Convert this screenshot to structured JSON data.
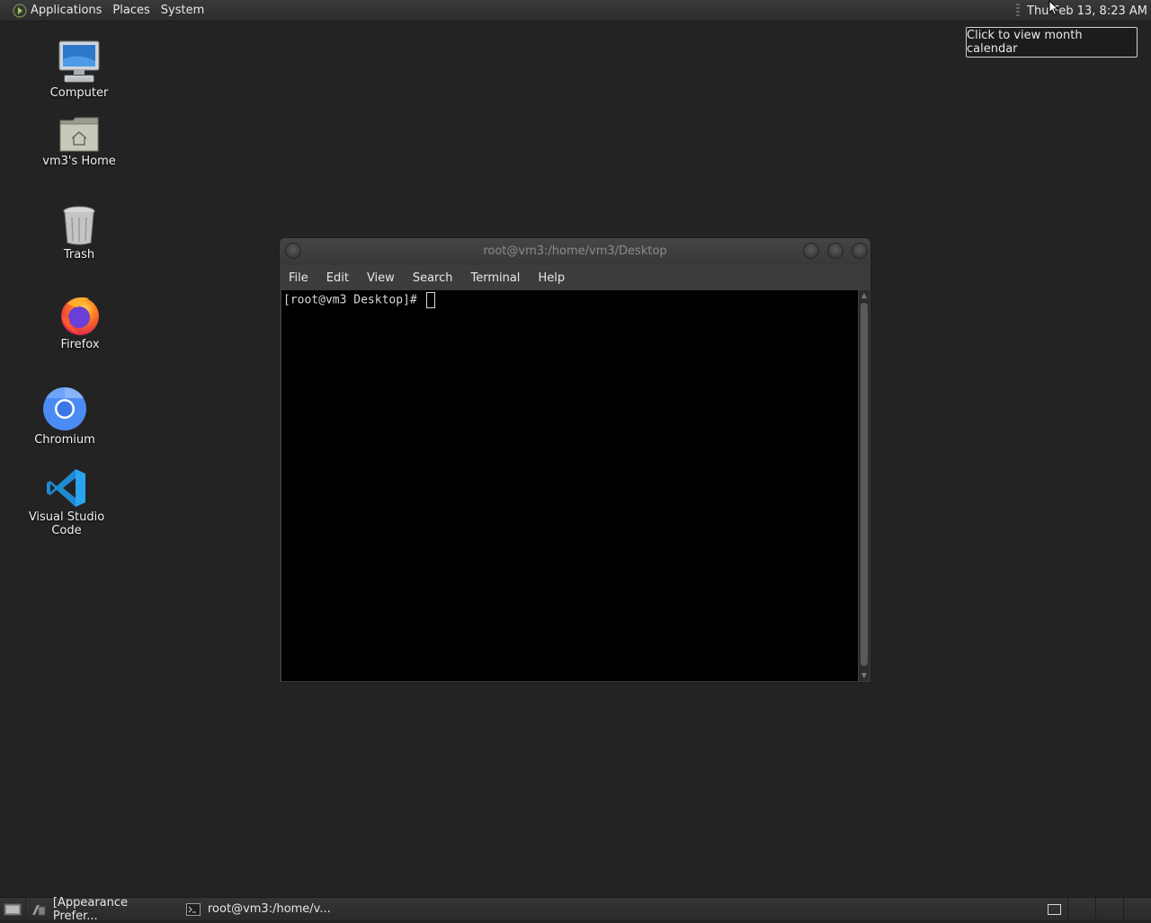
{
  "top_panel": {
    "menus": [
      "Applications",
      "Places",
      "System"
    ],
    "clock": "Thu Feb 13,  8:23 AM",
    "tooltip": "Click to view month calendar"
  },
  "desktop": {
    "icons": [
      {
        "label": "Computer",
        "icon": "computer-icon"
      },
      {
        "label": "vm3's Home",
        "icon": "home-folder-icon"
      },
      {
        "label": "Trash",
        "icon": "trash-icon"
      },
      {
        "label": "Firefox",
        "icon": "firefox-icon"
      },
      {
        "label": "Chromium",
        "icon": "chromium-icon"
      },
      {
        "label": "Visual Studio Code",
        "icon": "vscode-icon"
      }
    ]
  },
  "terminal": {
    "title": "root@vm3:/home/vm3/Desktop",
    "menu": [
      "File",
      "Edit",
      "View",
      "Search",
      "Terminal",
      "Help"
    ],
    "prompt": "[root@vm3 Desktop]# "
  },
  "taskbar": {
    "tasks": [
      {
        "label": "[Appearance Prefer...",
        "icon": "appearance-icon"
      },
      {
        "label": "root@vm3:/home/v...",
        "icon": "terminal-icon"
      }
    ]
  },
  "colors": {
    "desktop_bg": "#232323",
    "panel_bg": "#2c2c2c"
  }
}
